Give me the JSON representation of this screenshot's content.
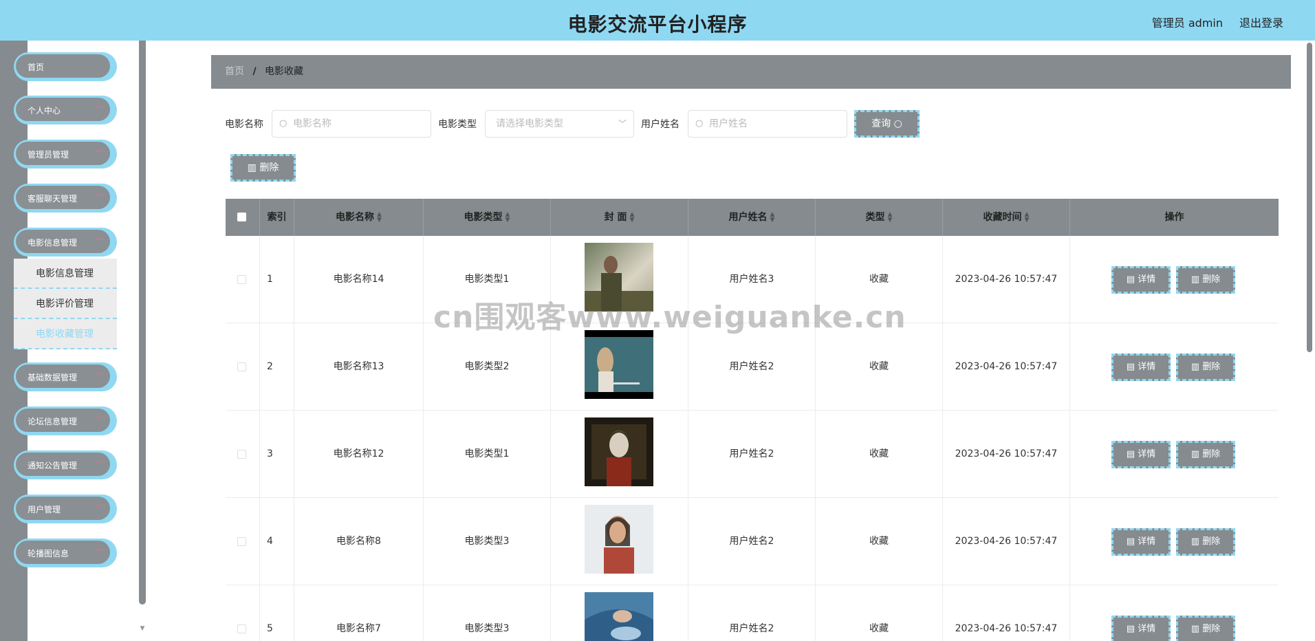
{
  "header": {
    "title": "电影交流平台小程序",
    "admin_label": "管理员 admin",
    "logout_label": "退出登录"
  },
  "sidebar": {
    "items": [
      {
        "label": "首页",
        "has_arrow": false
      },
      {
        "label": "个人中心",
        "has_arrow": true
      },
      {
        "label": "管理员管理",
        "has_arrow": true
      },
      {
        "label": "客服聊天管理",
        "has_arrow": true
      },
      {
        "label": "电影信息管理",
        "has_arrow": true
      },
      {
        "label": "基础数据管理",
        "has_arrow": true
      },
      {
        "label": "论坛信息管理",
        "has_arrow": true
      },
      {
        "label": "通知公告管理",
        "has_arrow": true
      },
      {
        "label": "用户管理",
        "has_arrow": true
      },
      {
        "label": "轮播图信息",
        "has_arrow": true
      }
    ],
    "submenu": [
      {
        "label": "电影信息管理"
      },
      {
        "label": "电影评价管理"
      },
      {
        "label": "电影收藏管理"
      }
    ]
  },
  "breadcrumb": {
    "home": "首页",
    "separator": "/",
    "current": "电影收藏"
  },
  "search": {
    "movie_name_label": "电影名称",
    "movie_name_placeholder": "电影名称",
    "movie_type_label": "电影类型",
    "movie_type_placeholder": "请选择电影类型",
    "user_name_label": "用户姓名",
    "user_name_placeholder": "用户姓名",
    "query_label": "查询"
  },
  "toolbar": {
    "delete_label": "删除"
  },
  "table": {
    "headers": [
      "",
      "索引",
      "电影名称",
      "电影类型",
      "封 面",
      "用户姓名",
      "类型",
      "收藏时间",
      "操作"
    ],
    "rows": [
      {
        "index": "1",
        "name": "电影名称14",
        "type": "电影类型1",
        "user": "用户姓名3",
        "kind": "收藏",
        "time": "2023-04-26 10:57:47"
      },
      {
        "index": "2",
        "name": "电影名称13",
        "type": "电影类型2",
        "user": "用户姓名2",
        "kind": "收藏",
        "time": "2023-04-26 10:57:47"
      },
      {
        "index": "3",
        "name": "电影名称12",
        "type": "电影类型1",
        "user": "用户姓名2",
        "kind": "收藏",
        "time": "2023-04-26 10:57:47"
      },
      {
        "index": "4",
        "name": "电影名称8",
        "type": "电影类型3",
        "user": "用户姓名2",
        "kind": "收藏",
        "time": "2023-04-26 10:57:47"
      },
      {
        "index": "5",
        "name": "电影名称7",
        "type": "电影类型3",
        "user": "用户姓名2",
        "kind": "收藏",
        "time": "2023-04-26 10:57:47"
      }
    ],
    "detail_label": "详情",
    "delete_label": "删除"
  },
  "watermark": "cn围观客www.weiguanke.cn",
  "colors": {
    "header": "#8fd8f2",
    "accent": "#8fd8f2",
    "gray": "#858b8f"
  }
}
